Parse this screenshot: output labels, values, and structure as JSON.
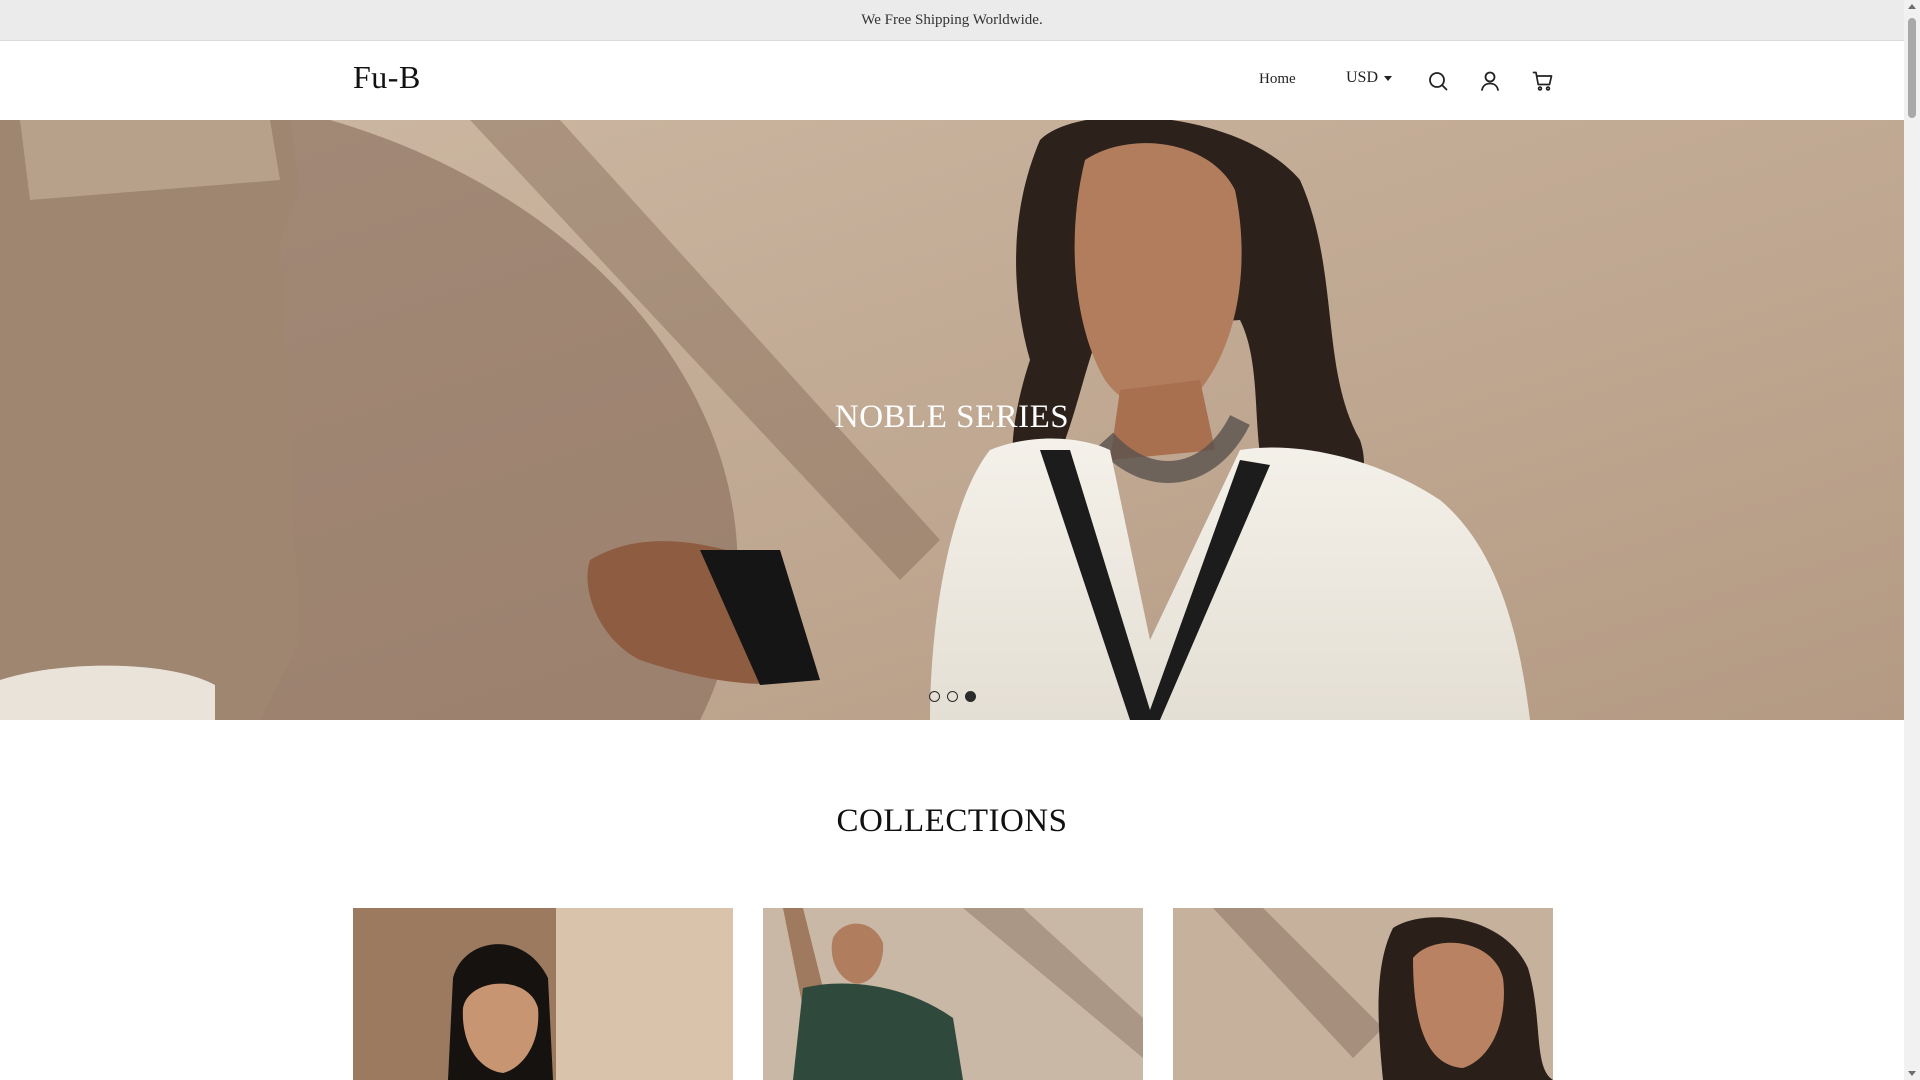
{
  "announcement": {
    "text": "We Free Shipping Worldwide."
  },
  "header": {
    "logo": "Fu-B",
    "nav": {
      "home": "Home"
    },
    "currency": {
      "selected": "USD"
    },
    "icons": [
      "search-icon",
      "account-icon",
      "cart-icon"
    ]
  },
  "hero": {
    "title": "NOBLE SERIES",
    "slides_total": 3,
    "active_slide": 3
  },
  "collections": {
    "title": "COLLECTIONS",
    "items": [
      "collection-1",
      "collection-2",
      "collection-3"
    ]
  },
  "colors": {
    "announcement_bg": "#ebebeb",
    "text_dark": "#111111",
    "hero_text": "#ffffff"
  }
}
